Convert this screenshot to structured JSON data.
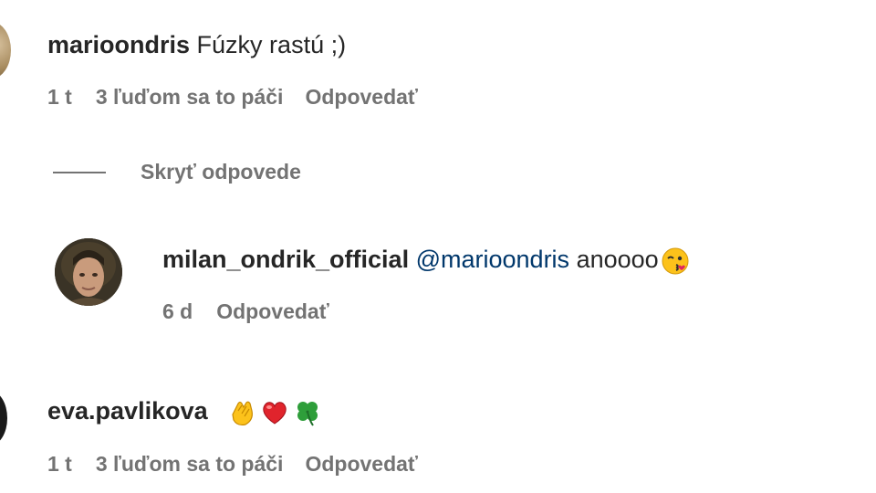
{
  "comments": [
    {
      "username": "marioondris",
      "text": "Fúzky rastú ;)",
      "time": "1 t",
      "likes": "3 ľuďom sa to páči",
      "reply": "Odpovedať"
    },
    {
      "username": "eva.pavlikova",
      "text": "",
      "emojis": [
        "clapping-hands-emoji",
        "red-heart-emoji",
        "four-leaf-clover-emoji"
      ],
      "time": "1 t",
      "likes": "3 ľuďom sa to páči",
      "reply": "Odpovedať"
    }
  ],
  "replies_toggle": {
    "label": "Skryť odpovede"
  },
  "reply": {
    "username": "milan_ondrik_official",
    "mention": "@marioondris",
    "text": "anoooo",
    "emoji": "winking-kiss-face-emoji",
    "time": "6 d",
    "reply": "Odpovedať"
  },
  "colors": {
    "text": "#262626",
    "secondary": "#737373",
    "mention": "#00376b",
    "background": "#ffffff"
  }
}
